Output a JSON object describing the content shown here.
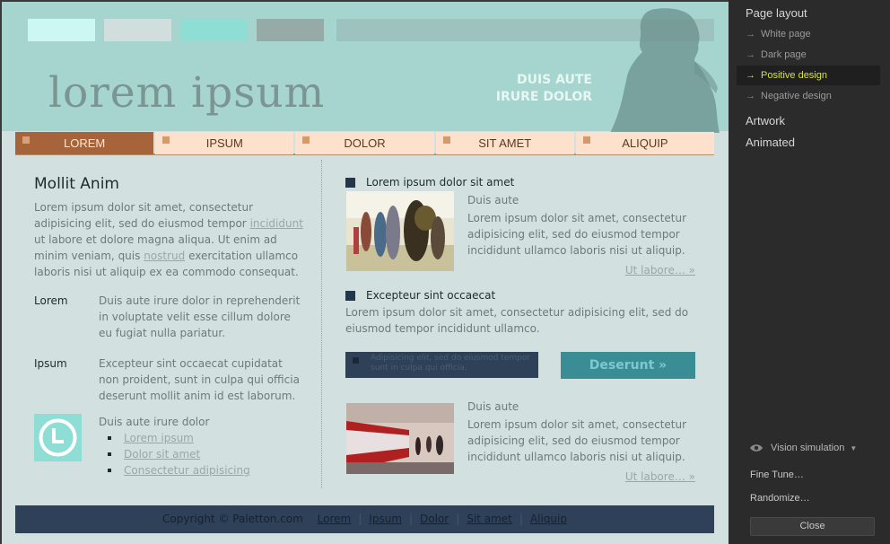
{
  "site": {
    "swatches": [
      "#ccf7f2",
      "#d2dedd",
      "#8fded6",
      "#96aaa8",
      "#9ec3bf"
    ],
    "logo": "lorem ipsum",
    "tagline_line1": "DUIS AUTE",
    "tagline_line2": "IRURE DOLOR",
    "nav": [
      {
        "label": "LOREM",
        "active": true
      },
      {
        "label": "IPSUM",
        "active": false
      },
      {
        "label": "DOLOR",
        "active": false
      },
      {
        "label": "SIT AMET",
        "active": false
      },
      {
        "label": "ALIQUIP",
        "active": false
      }
    ],
    "left": {
      "title": "Mollit Anim",
      "p1_a": "Lorem ipsum dolor sit amet, consectetur adipisicing elit, sed do eiusmod tempor ",
      "p1_link1": "incididunt",
      "p1_b": " ut labore et dolore magna aliqua. Ut enim ad minim veniam, quis ",
      "p1_link2": "nostrud",
      "p1_c": " exercitation ullamco laboris nisi ut aliquip ex ea commodo consequat.",
      "defs": [
        {
          "term": "Lorem",
          "desc": "Duis aute irure dolor in reprehenderit in voluptate velit esse cillum dolore eu fugiat nulla pariatur."
        },
        {
          "term": "Ipsum",
          "desc": "Excepteur sint occaecat cupidatat non proident, sunt in culpa qui officia deserunt mollit anim id est laborum."
        }
      ],
      "list_title": "Duis aute irure dolor",
      "list_links": [
        "Lorem ipsum",
        "Dolor sit amet",
        "Consectetur adipisicing"
      ]
    },
    "right": {
      "head1": "Lorem ipsum dolor sit amet",
      "art1_sub": "Duis aute",
      "art1_text": "Lorem ipsum dolor sit amet, consectetur adipisicing elit, sed do eiusmod tempor incididunt ullamco laboris nisi ut aliquip.",
      "more1": "Ut labore… »",
      "head2": "Excepteur sint occaecat",
      "p2": "Lorem ipsum dolor sit amet, consectetur adipisicing elit, sed do eiusmod tempor incididunt ullamco.",
      "infobar": "Adipisicing elit, sed do eiusmod tempor sunt in culpa qui officia.",
      "cta": "Deserunt »",
      "art2_sub": "Duis aute",
      "art2_text": "Lorem ipsum dolor sit amet, consectetur adipisicing elit, sed do eiusmod tempor incididunt ullamco laboris nisi ut aliquip.",
      "more2": "Ut labore… »"
    },
    "footer": {
      "copyright": "Copyright © Paletton.com",
      "links": [
        "Lorem",
        "Ipsum",
        "Dolor",
        "Sit amet",
        "Aliquip"
      ]
    }
  },
  "panel": {
    "section1": "Page layout",
    "layouts": [
      {
        "label": "White page",
        "selected": false
      },
      {
        "label": "Dark page",
        "selected": false
      },
      {
        "label": "Positive design",
        "selected": true
      },
      {
        "label": "Negative design",
        "selected": false
      }
    ],
    "section2": "Artwork",
    "section3": "Animated",
    "vision": "Vision simulation",
    "fine_tune": "Fine Tune…",
    "randomize": "Randomize…",
    "close": "Close"
  }
}
